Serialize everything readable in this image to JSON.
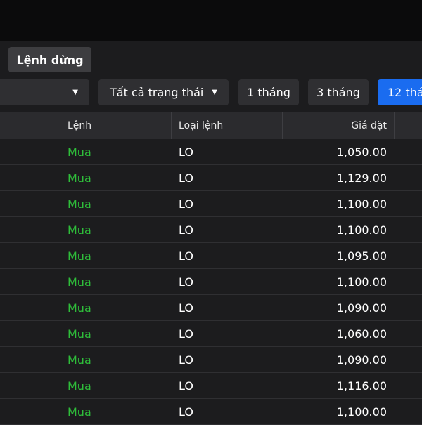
{
  "stop_order_tab": "Lệnh dừng",
  "filters": {
    "status_dropdown": "Tất cả trạng thái",
    "periods": [
      "1 tháng",
      "3 tháng",
      "12 thá"
    ],
    "active_period": "12 thá"
  },
  "table": {
    "headers": {
      "side": "Lệnh",
      "order_type": "Loại lệnh",
      "price": "Giá đặt"
    },
    "rows": [
      {
        "side": "Mua",
        "order_type": "LO",
        "price": "1,050.00"
      },
      {
        "side": "Mua",
        "order_type": "LO",
        "price": "1,129.00"
      },
      {
        "side": "Mua",
        "order_type": "LO",
        "price": "1,100.00"
      },
      {
        "side": "Mua",
        "order_type": "LO",
        "price": "1,100.00"
      },
      {
        "side": "Mua",
        "order_type": "LO",
        "price": "1,095.00"
      },
      {
        "side": "Mua",
        "order_type": "LO",
        "price": "1,100.00"
      },
      {
        "side": "Mua",
        "order_type": "LO",
        "price": "1,090.00"
      },
      {
        "side": "Mua",
        "order_type": "LO",
        "price": "1,060.00"
      },
      {
        "side": "Mua",
        "order_type": "LO",
        "price": "1,090.00"
      },
      {
        "side": "Mua",
        "order_type": "LO",
        "price": "1,116.00"
      },
      {
        "side": "Mua",
        "order_type": "LO",
        "price": "1,100.00"
      }
    ]
  },
  "colors": {
    "buy": "#2ebd3a",
    "active": "#1a6cf0"
  }
}
